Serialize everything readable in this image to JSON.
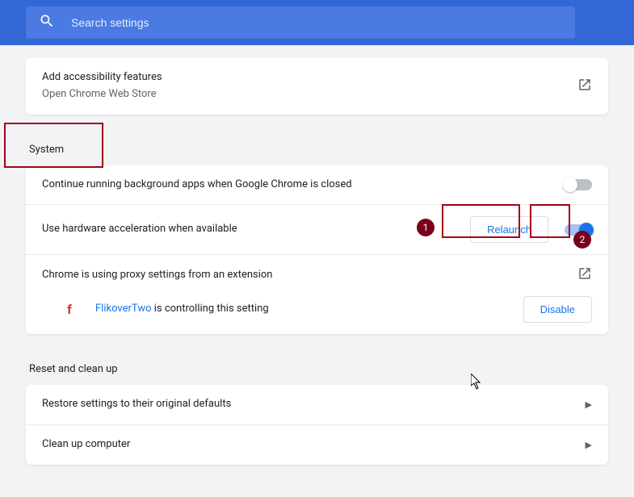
{
  "search": {
    "placeholder": "Search settings"
  },
  "accessibility": {
    "title": "Add accessibility features",
    "subtitle": "Open Chrome Web Store"
  },
  "system": {
    "heading": "System",
    "bg_apps": "Continue running background apps when Google Chrome is closed",
    "hw_accel": "Use hardware acceleration when available",
    "relaunch": "Relaunch",
    "proxy": "Chrome is using proxy settings from an extension",
    "ext_name": "FlikoverTwo",
    "ext_suffix": " is controlling this setting",
    "disable": "Disable"
  },
  "reset": {
    "heading": "Reset and clean up",
    "restore": "Restore settings to their original defaults",
    "cleanup": "Clean up computer"
  },
  "annotations": {
    "1": "1",
    "2": "2"
  }
}
